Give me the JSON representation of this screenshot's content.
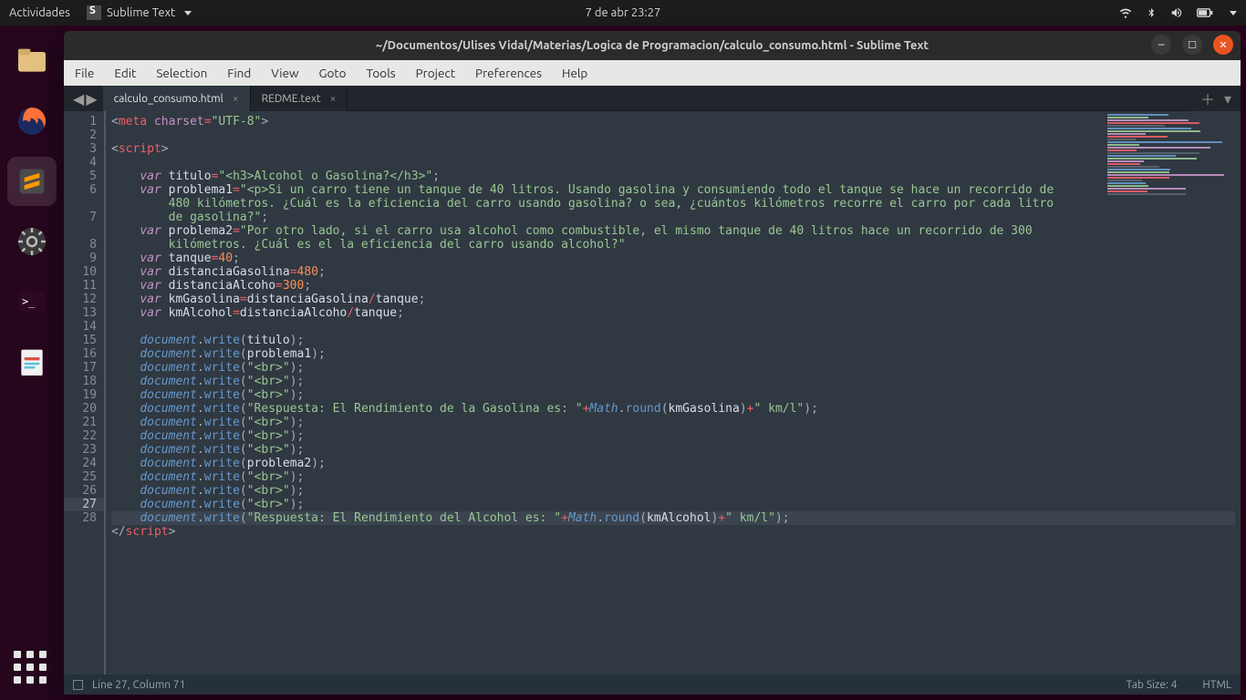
{
  "panel": {
    "activities": "Actividades",
    "app_name": "Sublime Text",
    "clock": "7 de abr  23:27"
  },
  "window": {
    "title": "~/Documentos/Ulises Vidal/Materias/Logica de Programacion/calculo_consumo.html - Sublime Text"
  },
  "menubar": [
    "File",
    "Edit",
    "Selection",
    "Find",
    "View",
    "Goto",
    "Tools",
    "Project",
    "Preferences",
    "Help"
  ],
  "tabs": [
    {
      "label": "calculo_consumo.html",
      "active": true
    },
    {
      "label": "REDME.text",
      "active": false
    }
  ],
  "gutter": {
    "lines": [
      1,
      2,
      3,
      4,
      5,
      6,
      "",
      7,
      "",
      8,
      9,
      10,
      11,
      12,
      13,
      14,
      15,
      16,
      17,
      18,
      19,
      20,
      21,
      22,
      23,
      24,
      25,
      26,
      27,
      28
    ],
    "highlight_index": 28
  },
  "code_lines": [
    {
      "segs": [
        [
          "<",
          "ang"
        ],
        [
          "meta",
          "tag"
        ],
        [
          " ",
          "pun"
        ],
        [
          "charset",
          "attr"
        ],
        [
          "=",
          "op"
        ],
        [
          "\"UTF-8\"",
          "str"
        ],
        [
          ">",
          "ang"
        ]
      ]
    },
    {
      "segs": []
    },
    {
      "segs": [
        [
          "<",
          "ang"
        ],
        [
          "script",
          "tag"
        ],
        [
          ">",
          "ang"
        ]
      ]
    },
    {
      "segs": []
    },
    {
      "segs": [
        [
          "    ",
          "pun"
        ],
        [
          "var ",
          "kw"
        ],
        [
          "titulo",
          "var"
        ],
        [
          "=",
          "op"
        ],
        [
          "\"<h3>Alcohol o Gasolina?</h3>\"",
          "str"
        ],
        [
          ";",
          "pun"
        ]
      ]
    },
    {
      "segs": [
        [
          "    ",
          "pun"
        ],
        [
          "var ",
          "kw"
        ],
        [
          "problema1",
          "var"
        ],
        [
          "=",
          "op"
        ],
        [
          "\"<p>Si un carro tiene un tanque de 40 litros. Usando gasolina y consumiendo todo el tanque se hace un recorrido de ",
          "str"
        ]
      ]
    },
    {
      "segs": [
        [
          "        480 kilómetros. ¿Cuál es la eficiencia del carro usando gasolina? o sea, ¿cuántos kilómetros recorre el carro por cada litro ",
          "str"
        ]
      ]
    },
    {
      "segs": [
        [
          "        de gasolina?\"",
          "str"
        ],
        [
          ";",
          "pun"
        ]
      ]
    },
    {
      "segs": [
        [
          "    ",
          "pun"
        ],
        [
          "var ",
          "kw"
        ],
        [
          "problema2",
          "var"
        ],
        [
          "=",
          "op"
        ],
        [
          "\"Por otro lado, si el carro usa alcohol como combustible, el mismo tanque de 40 litros hace un recorrido de 300 ",
          "str"
        ]
      ]
    },
    {
      "segs": [
        [
          "        kilómetros. ¿Cuál es el la eficiencia del carro usando alcohol?\"",
          "str"
        ]
      ]
    },
    {
      "segs": [
        [
          "    ",
          "pun"
        ],
        [
          "var ",
          "kw"
        ],
        [
          "tanque",
          "var"
        ],
        [
          "=",
          "op"
        ],
        [
          "40",
          "num"
        ],
        [
          ";",
          "pun"
        ]
      ]
    },
    {
      "segs": [
        [
          "    ",
          "pun"
        ],
        [
          "var ",
          "kw"
        ],
        [
          "distanciaGasolina",
          "var"
        ],
        [
          "=",
          "op"
        ],
        [
          "480",
          "num"
        ],
        [
          ";",
          "pun"
        ]
      ]
    },
    {
      "segs": [
        [
          "    ",
          "pun"
        ],
        [
          "var ",
          "kw"
        ],
        [
          "distanciaAlcoho",
          "var"
        ],
        [
          "=",
          "op"
        ],
        [
          "300",
          "num"
        ],
        [
          ";",
          "pun"
        ]
      ]
    },
    {
      "segs": [
        [
          "    ",
          "pun"
        ],
        [
          "var ",
          "kw"
        ],
        [
          "kmGasolina",
          "var"
        ],
        [
          "=",
          "op"
        ],
        [
          "distanciaGasolina",
          "var"
        ],
        [
          "/",
          "op"
        ],
        [
          "tanque",
          "var"
        ],
        [
          ";",
          "pun"
        ]
      ]
    },
    {
      "segs": [
        [
          "    ",
          "pun"
        ],
        [
          "var ",
          "kw"
        ],
        [
          "kmAlcohol",
          "var"
        ],
        [
          "=",
          "op"
        ],
        [
          "distanciaAlcoho",
          "var"
        ],
        [
          "/",
          "op"
        ],
        [
          "tanque",
          "var"
        ],
        [
          ";",
          "pun"
        ]
      ]
    },
    {
      "segs": []
    },
    {
      "segs": [
        [
          "    ",
          "pun"
        ],
        [
          "document",
          "obj"
        ],
        [
          ".",
          "pun"
        ],
        [
          "write",
          "fn"
        ],
        [
          "(",
          "pun"
        ],
        [
          "titulo",
          "var"
        ],
        [
          ")",
          "pun"
        ],
        [
          ";",
          "pun"
        ]
      ]
    },
    {
      "segs": [
        [
          "    ",
          "pun"
        ],
        [
          "document",
          "obj"
        ],
        [
          ".",
          "pun"
        ],
        [
          "write",
          "fn"
        ],
        [
          "(",
          "pun"
        ],
        [
          "problema1",
          "var"
        ],
        [
          ")",
          "pun"
        ],
        [
          ";",
          "pun"
        ]
      ]
    },
    {
      "segs": [
        [
          "    ",
          "pun"
        ],
        [
          "document",
          "obj"
        ],
        [
          ".",
          "pun"
        ],
        [
          "write",
          "fn"
        ],
        [
          "(",
          "pun"
        ],
        [
          "\"<br>\"",
          "str"
        ],
        [
          ")",
          "pun"
        ],
        [
          ";",
          "pun"
        ]
      ]
    },
    {
      "segs": [
        [
          "    ",
          "pun"
        ],
        [
          "document",
          "obj"
        ],
        [
          ".",
          "pun"
        ],
        [
          "write",
          "fn"
        ],
        [
          "(",
          "pun"
        ],
        [
          "\"<br>\"",
          "str"
        ],
        [
          ")",
          "pun"
        ],
        [
          ";",
          "pun"
        ]
      ]
    },
    {
      "segs": [
        [
          "    ",
          "pun"
        ],
        [
          "document",
          "obj"
        ],
        [
          ".",
          "pun"
        ],
        [
          "write",
          "fn"
        ],
        [
          "(",
          "pun"
        ],
        [
          "\"<br>\"",
          "str"
        ],
        [
          ")",
          "pun"
        ],
        [
          ";",
          "pun"
        ]
      ]
    },
    {
      "segs": [
        [
          "    ",
          "pun"
        ],
        [
          "document",
          "obj"
        ],
        [
          ".",
          "pun"
        ],
        [
          "write",
          "fn"
        ],
        [
          "(",
          "pun"
        ],
        [
          "\"Respuesta: El Rendimiento de la Gasolina es: \"",
          "str"
        ],
        [
          "+",
          "op"
        ],
        [
          "Math",
          "obj"
        ],
        [
          ".",
          "pun"
        ],
        [
          "round",
          "fn"
        ],
        [
          "(",
          "pun"
        ],
        [
          "kmGasolina",
          "var"
        ],
        [
          ")",
          "pun"
        ],
        [
          "+",
          "op"
        ],
        [
          "\" km/l\"",
          "str"
        ],
        [
          ")",
          "pun"
        ],
        [
          ";",
          "pun"
        ]
      ]
    },
    {
      "segs": [
        [
          "    ",
          "pun"
        ],
        [
          "document",
          "obj"
        ],
        [
          ".",
          "pun"
        ],
        [
          "write",
          "fn"
        ],
        [
          "(",
          "pun"
        ],
        [
          "\"<br>\"",
          "str"
        ],
        [
          ")",
          "pun"
        ],
        [
          ";",
          "pun"
        ]
      ]
    },
    {
      "segs": [
        [
          "    ",
          "pun"
        ],
        [
          "document",
          "obj"
        ],
        [
          ".",
          "pun"
        ],
        [
          "write",
          "fn"
        ],
        [
          "(",
          "pun"
        ],
        [
          "\"<br>\"",
          "str"
        ],
        [
          ")",
          "pun"
        ],
        [
          ";",
          "pun"
        ]
      ]
    },
    {
      "segs": [
        [
          "    ",
          "pun"
        ],
        [
          "document",
          "obj"
        ],
        [
          ".",
          "pun"
        ],
        [
          "write",
          "fn"
        ],
        [
          "(",
          "pun"
        ],
        [
          "\"<br>\"",
          "str"
        ],
        [
          ")",
          "pun"
        ],
        [
          ";",
          "pun"
        ]
      ]
    },
    {
      "segs": [
        [
          "    ",
          "pun"
        ],
        [
          "document",
          "obj"
        ],
        [
          ".",
          "pun"
        ],
        [
          "write",
          "fn"
        ],
        [
          "(",
          "pun"
        ],
        [
          "problema2",
          "var"
        ],
        [
          ")",
          "pun"
        ],
        [
          ";",
          "pun"
        ]
      ]
    },
    {
      "segs": [
        [
          "    ",
          "pun"
        ],
        [
          "document",
          "obj"
        ],
        [
          ".",
          "pun"
        ],
        [
          "write",
          "fn"
        ],
        [
          "(",
          "pun"
        ],
        [
          "\"<br>\"",
          "str"
        ],
        [
          ")",
          "pun"
        ],
        [
          ";",
          "pun"
        ]
      ]
    },
    {
      "segs": [
        [
          "    ",
          "pun"
        ],
        [
          "document",
          "obj"
        ],
        [
          ".",
          "pun"
        ],
        [
          "write",
          "fn"
        ],
        [
          "(",
          "pun"
        ],
        [
          "\"<br>\"",
          "str"
        ],
        [
          ")",
          "pun"
        ],
        [
          ";",
          "pun"
        ]
      ]
    },
    {
      "segs": [
        [
          "    ",
          "pun"
        ],
        [
          "document",
          "obj"
        ],
        [
          ".",
          "pun"
        ],
        [
          "write",
          "fn"
        ],
        [
          "(",
          "pun"
        ],
        [
          "\"<br>\"",
          "str"
        ],
        [
          ")",
          "pun"
        ],
        [
          ";",
          "pun"
        ]
      ]
    },
    {
      "hl": true,
      "segs": [
        [
          "    ",
          "pun"
        ],
        [
          "document",
          "obj"
        ],
        [
          ".",
          "pun"
        ],
        [
          "write",
          "fn"
        ],
        [
          "(",
          "pun"
        ],
        [
          "\"Respuesta: El Rendimiento del Alcohol es: \"",
          "str"
        ],
        [
          "+",
          "op"
        ],
        [
          "Math",
          "obj"
        ],
        [
          ".",
          "pun"
        ],
        [
          "round",
          "fn"
        ],
        [
          "(",
          "pun"
        ],
        [
          "kmAlcohol",
          "var"
        ],
        [
          ")",
          "pun"
        ],
        [
          "+",
          "op"
        ],
        [
          "\" km/l\"",
          "str"
        ],
        [
          ")",
          "pun"
        ],
        [
          ";",
          "pun"
        ]
      ]
    },
    {
      "segs": [
        [
          "</",
          "ang"
        ],
        [
          "script",
          "tag"
        ],
        [
          ">",
          "ang"
        ]
      ]
    }
  ],
  "status": {
    "cursor": "Line 27, Column 71",
    "tabsize": "Tab Size: 4",
    "syntax": "HTML"
  }
}
